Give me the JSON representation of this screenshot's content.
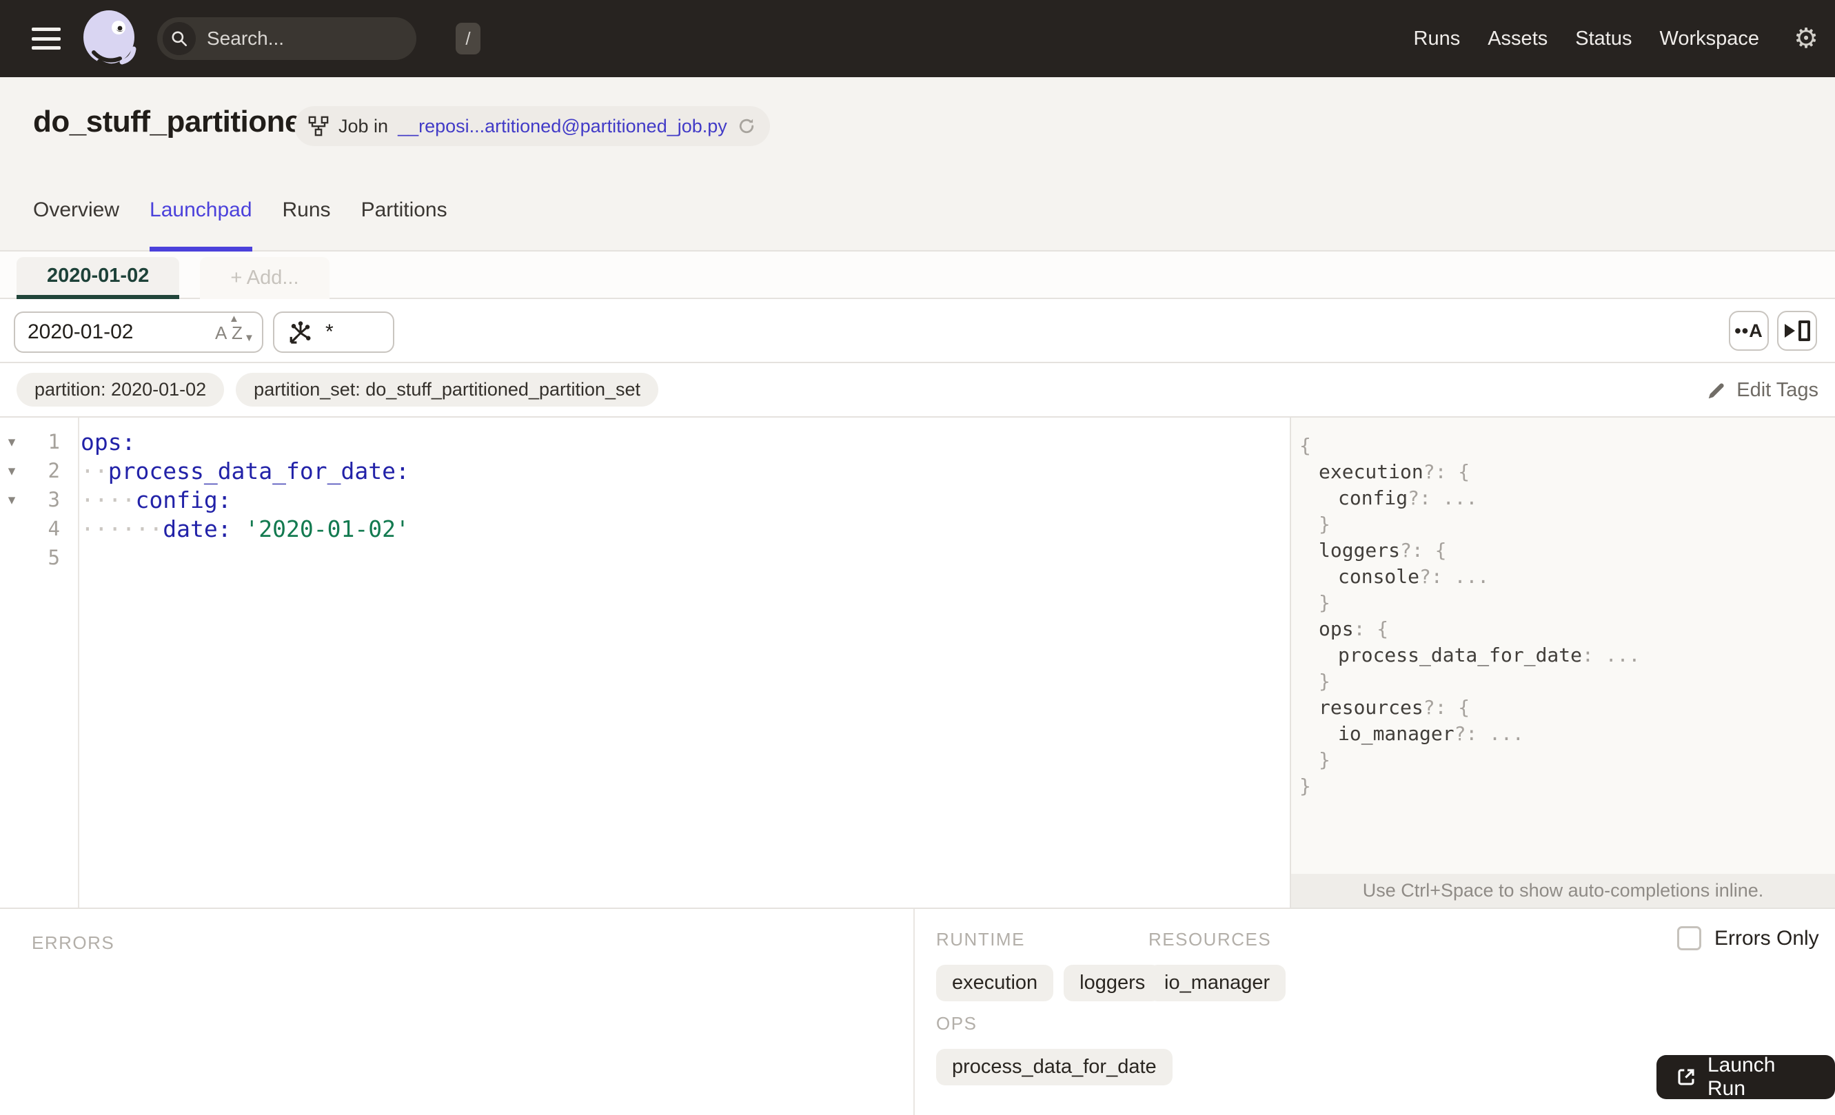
{
  "topnav": {
    "search": {
      "placeholder": "Search...",
      "shortcut": "/"
    },
    "links": [
      {
        "label": "Runs"
      },
      {
        "label": "Assets"
      },
      {
        "label": "Status"
      },
      {
        "label": "Workspace"
      }
    ]
  },
  "header": {
    "title": "do_stuff_partitioned",
    "job_badge": {
      "prefix": "Job in",
      "link": "__reposi...artitioned@partitioned_job.py"
    },
    "tabs": [
      {
        "label": "Overview",
        "active": false
      },
      {
        "label": "Launchpad",
        "active": true
      },
      {
        "label": "Runs",
        "active": false
      },
      {
        "label": "Partitions",
        "active": false
      }
    ]
  },
  "launchpad": {
    "config_tabs": [
      {
        "label": "2020-01-02",
        "active": true
      },
      {
        "label": "+ Add...",
        "active": false
      }
    ],
    "partition_select": {
      "value": "2020-01-02"
    },
    "op_selector": {
      "value": "*"
    },
    "toolbar": {
      "autocomplete_glyph": "••A"
    },
    "tags": [
      {
        "text": "partition: 2020-01-02"
      },
      {
        "text": "partition_set: do_stuff_partitioned_partition_set"
      }
    ],
    "edit_tags_label": "Edit Tags",
    "editor": {
      "lines": [
        {
          "num": "1",
          "fold": true,
          "dots": 0,
          "key": "ops",
          "value": ""
        },
        {
          "num": "2",
          "fold": true,
          "dots": 2,
          "key": "process_data_for_date",
          "value": ""
        },
        {
          "num": "3",
          "fold": true,
          "dots": 4,
          "key": "config",
          "value": ""
        },
        {
          "num": "4",
          "fold": false,
          "dots": 6,
          "key": "date",
          "value": "'2020-01-02'"
        },
        {
          "num": "5",
          "fold": false,
          "dots": 0,
          "key": "",
          "value": ""
        }
      ]
    },
    "schema": {
      "lines": [
        {
          "indent": 0,
          "segments": [
            {
              "text": "{",
              "kind": "punct"
            }
          ]
        },
        {
          "indent": 1,
          "segments": [
            {
              "text": "execution",
              "kind": "key"
            },
            {
              "text": "?: {",
              "kind": "punct"
            }
          ]
        },
        {
          "indent": 2,
          "segments": [
            {
              "text": "config",
              "kind": "key"
            },
            {
              "text": "?: ...",
              "kind": "punct"
            }
          ]
        },
        {
          "indent": 1,
          "segments": [
            {
              "text": "}",
              "kind": "punct"
            }
          ]
        },
        {
          "indent": 1,
          "segments": [
            {
              "text": "loggers",
              "kind": "key"
            },
            {
              "text": "?: {",
              "kind": "punct"
            }
          ]
        },
        {
          "indent": 2,
          "segments": [
            {
              "text": "console",
              "kind": "key"
            },
            {
              "text": "?: ...",
              "kind": "punct"
            }
          ]
        },
        {
          "indent": 1,
          "segments": [
            {
              "text": "}",
              "kind": "punct"
            }
          ]
        },
        {
          "indent": 1,
          "segments": [
            {
              "text": "ops",
              "kind": "key"
            },
            {
              "text": ": {",
              "kind": "punct"
            }
          ]
        },
        {
          "indent": 2,
          "segments": [
            {
              "text": "process_data_for_date",
              "kind": "key"
            },
            {
              "text": ": ...",
              "kind": "punct"
            }
          ]
        },
        {
          "indent": 1,
          "segments": [
            {
              "text": "}",
              "kind": "punct"
            }
          ]
        },
        {
          "indent": 1,
          "segments": [
            {
              "text": "resources",
              "kind": "key"
            },
            {
              "text": "?: {",
              "kind": "punct"
            }
          ]
        },
        {
          "indent": 2,
          "segments": [
            {
              "text": "io_manager",
              "kind": "key"
            },
            {
              "text": "?: ...",
              "kind": "punct"
            }
          ]
        },
        {
          "indent": 1,
          "segments": [
            {
              "text": "}",
              "kind": "punct"
            }
          ]
        },
        {
          "indent": 0,
          "segments": [
            {
              "text": "}",
              "kind": "punct"
            }
          ]
        }
      ],
      "hint": "Use Ctrl+Space to show auto-completions inline."
    },
    "bottom": {
      "errors_label": "ERRORS",
      "groups": [
        {
          "label": "RUNTIME",
          "items": [
            "execution",
            "loggers"
          ]
        },
        {
          "label": "RESOURCES",
          "items": [
            "io_manager"
          ]
        },
        {
          "label": "OPS",
          "items": [
            "process_data_for_date"
          ]
        }
      ],
      "errors_only_label": "Errors Only",
      "errors_only_checked": false,
      "launch_label": "Launch Run"
    }
  },
  "colors": {
    "topbar_bg": "#272320",
    "accent_indigo": "#4B41DB",
    "accent_green": "#21453A",
    "code_key": "#2222A8",
    "code_string": "#137A50"
  }
}
